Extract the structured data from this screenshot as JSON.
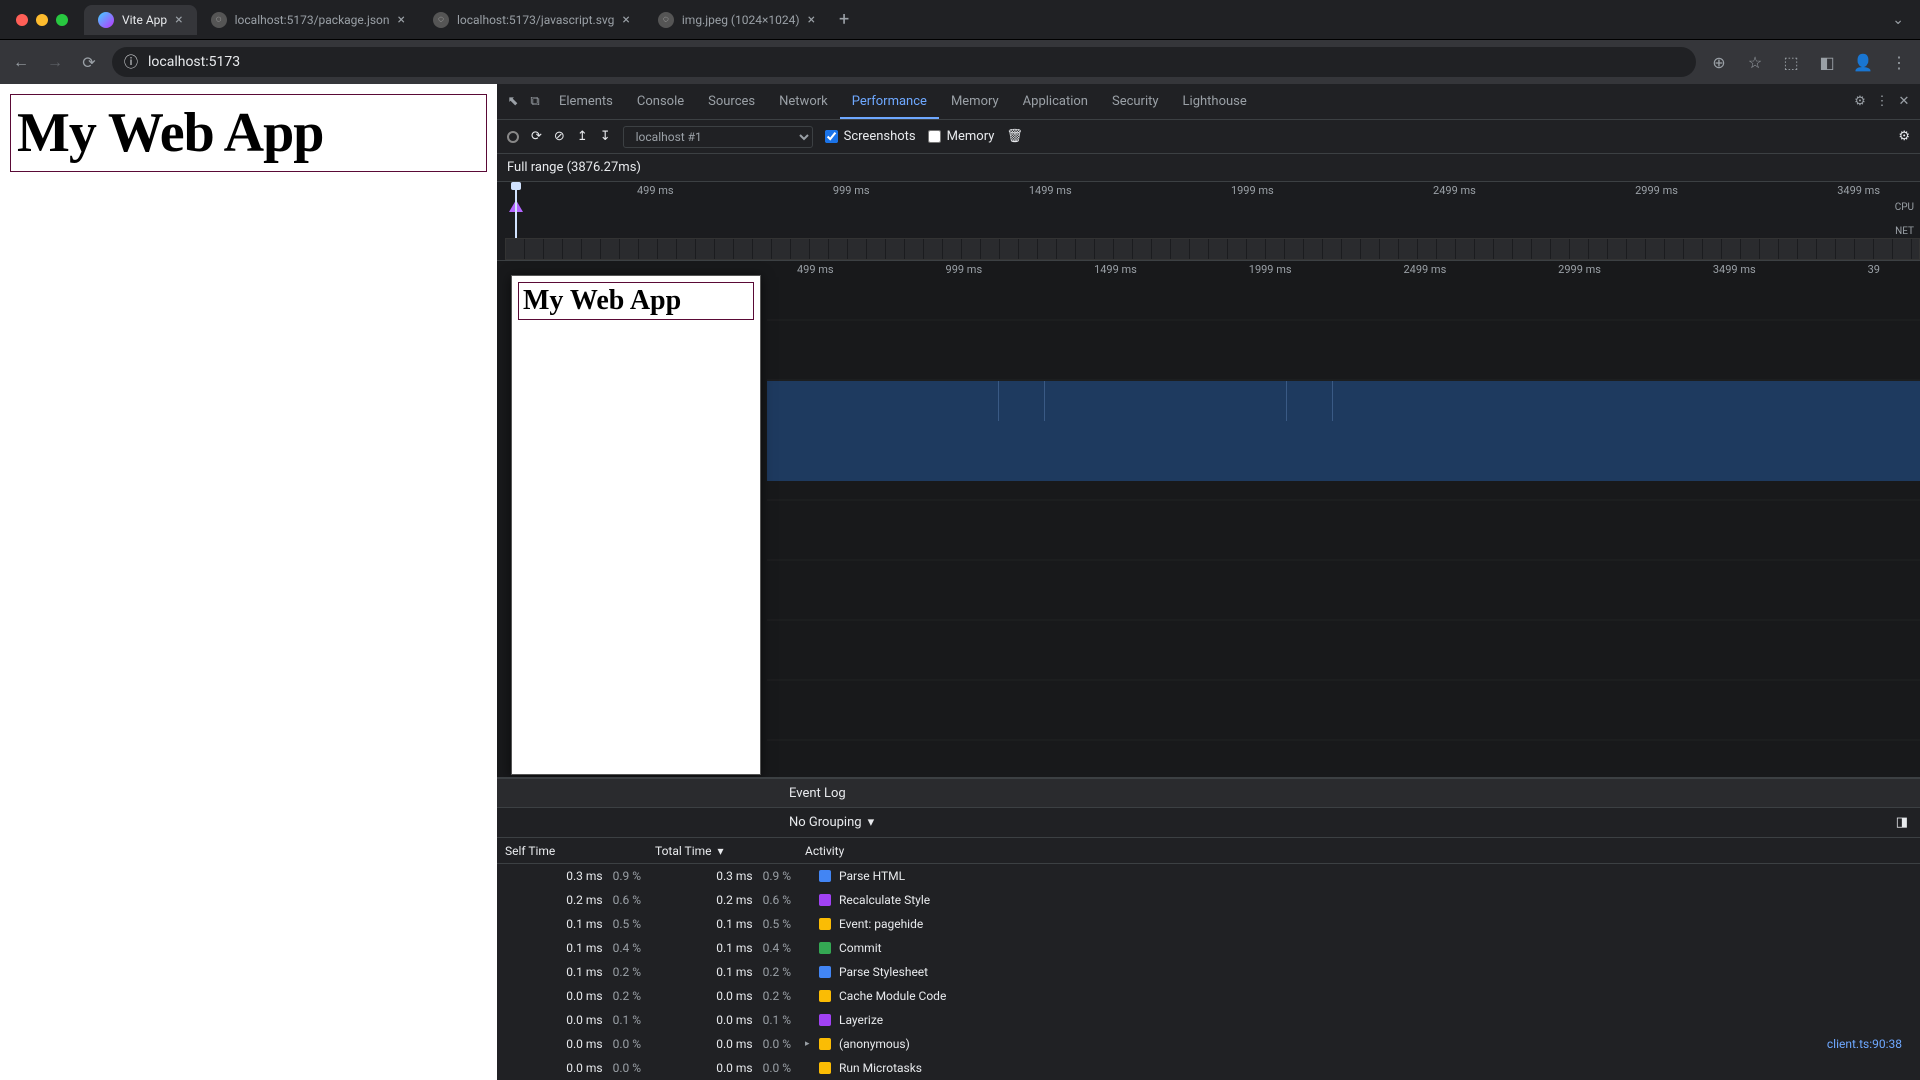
{
  "browser": {
    "tabs": [
      {
        "title": "Vite App",
        "active": true
      },
      {
        "title": "localhost:5173/package.json",
        "active": false
      },
      {
        "title": "localhost:5173/javascript.svg",
        "active": false
      },
      {
        "title": "img.jpeg (1024×1024)",
        "active": false
      }
    ],
    "url": "localhost:5173"
  },
  "page": {
    "heading": "My Web App"
  },
  "devtools": {
    "tabs": [
      "Elements",
      "Console",
      "Sources",
      "Network",
      "Performance",
      "Memory",
      "Application",
      "Security",
      "Lighthouse"
    ],
    "active_tab": "Performance",
    "toolbar": {
      "recording_select": "localhost #1",
      "screenshots_checked": true,
      "screenshots_label": "Screenshots",
      "memory_checked": false,
      "memory_label": "Memory"
    },
    "range_label": "Full range (3876.27ms)",
    "overview_ticks": [
      "499 ms",
      "999 ms",
      "1499 ms",
      "1999 ms",
      "2499 ms",
      "2999 ms",
      "3499 ms"
    ],
    "cpu_label": "CPU",
    "net_label": "NET",
    "flame_ticks": [
      "499 ms",
      "999 ms",
      "1499 ms",
      "1999 ms",
      "2499 ms",
      "2999 ms",
      "3499 ms",
      "39"
    ],
    "thumb_heading": "My Web App",
    "event_log_label": "Event Log",
    "grouping_label": "No Grouping",
    "table": {
      "headers": {
        "self": "Self Time",
        "total": "Total Time",
        "activity": "Activity"
      },
      "rows": [
        {
          "self_ms": "0.3 ms",
          "self_pc": "0.9 %",
          "total_ms": "0.3 ms",
          "total_pc": "0.9 %",
          "color": "#4285f4",
          "name": "Parse HTML",
          "expand": ""
        },
        {
          "self_ms": "0.2 ms",
          "self_pc": "0.6 %",
          "total_ms": "0.2 ms",
          "total_pc": "0.6 %",
          "color": "#a142f4",
          "name": "Recalculate Style",
          "expand": ""
        },
        {
          "self_ms": "0.1 ms",
          "self_pc": "0.5 %",
          "total_ms": "0.1 ms",
          "total_pc": "0.5 %",
          "color": "#fbbc04",
          "name": "Event: pagehide",
          "expand": ""
        },
        {
          "self_ms": "0.1 ms",
          "self_pc": "0.4 %",
          "total_ms": "0.1 ms",
          "total_pc": "0.4 %",
          "color": "#34a853",
          "name": "Commit",
          "expand": ""
        },
        {
          "self_ms": "0.1 ms",
          "self_pc": "0.2 %",
          "total_ms": "0.1 ms",
          "total_pc": "0.2 %",
          "color": "#4285f4",
          "name": "Parse Stylesheet",
          "expand": ""
        },
        {
          "self_ms": "0.0 ms",
          "self_pc": "0.2 %",
          "total_ms": "0.0 ms",
          "total_pc": "0.2 %",
          "color": "#fbbc04",
          "name": "Cache Module Code",
          "expand": ""
        },
        {
          "self_ms": "0.0 ms",
          "self_pc": "0.1 %",
          "total_ms": "0.0 ms",
          "total_pc": "0.1 %",
          "color": "#a142f4",
          "name": "Layerize",
          "expand": ""
        },
        {
          "self_ms": "0.0 ms",
          "self_pc": "0.0 %",
          "total_ms": "0.0 ms",
          "total_pc": "0.0 %",
          "color": "#fbbc04",
          "name": "(anonymous)",
          "expand": "▸",
          "src": "client.ts:90:38"
        },
        {
          "self_ms": "0.0 ms",
          "self_pc": "0.0 %",
          "total_ms": "0.0 ms",
          "total_pc": "0.0 %",
          "color": "#fbbc04",
          "name": "Run Microtasks",
          "expand": ""
        }
      ]
    }
  }
}
